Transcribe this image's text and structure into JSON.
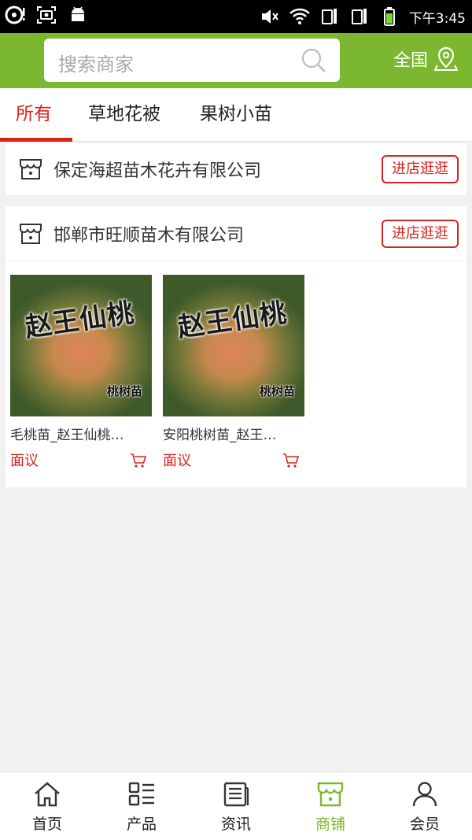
{
  "status_bar": {
    "time": "下午3:45"
  },
  "header": {
    "search_placeholder": "搜索商家",
    "region_label": "全国"
  },
  "tabs": [
    {
      "label": "所有",
      "active": true
    },
    {
      "label": "草地花被",
      "active": false
    },
    {
      "label": "果树小苗",
      "active": false
    }
  ],
  "stores": [
    {
      "name": "保定海超苗木花卉有限公司",
      "enter_label": "进店逛逛"
    },
    {
      "name": "邯郸市旺顺苗木有限公司",
      "enter_label": "进店逛逛"
    }
  ],
  "products": [
    {
      "name": "毛桃苗_赵王仙桃…",
      "price": "面议",
      "image_title": "赵王仙桃",
      "image_caption": "桃树苗"
    },
    {
      "name": "安阳桃树苗_赵王…",
      "price": "面议",
      "image_title": "赵王仙桃",
      "image_caption": "桃树苗"
    }
  ],
  "bottom_nav": [
    {
      "label": "首页",
      "icon": "home-icon",
      "active": false
    },
    {
      "label": "产品",
      "icon": "grid-list-icon",
      "active": false
    },
    {
      "label": "资讯",
      "icon": "news-icon",
      "active": false
    },
    {
      "label": "商铺",
      "icon": "shop-icon",
      "active": true
    },
    {
      "label": "会员",
      "icon": "user-icon",
      "active": false
    }
  ],
  "colors": {
    "brand_green": "#7cb82f",
    "accent_red": "#d8231c"
  }
}
